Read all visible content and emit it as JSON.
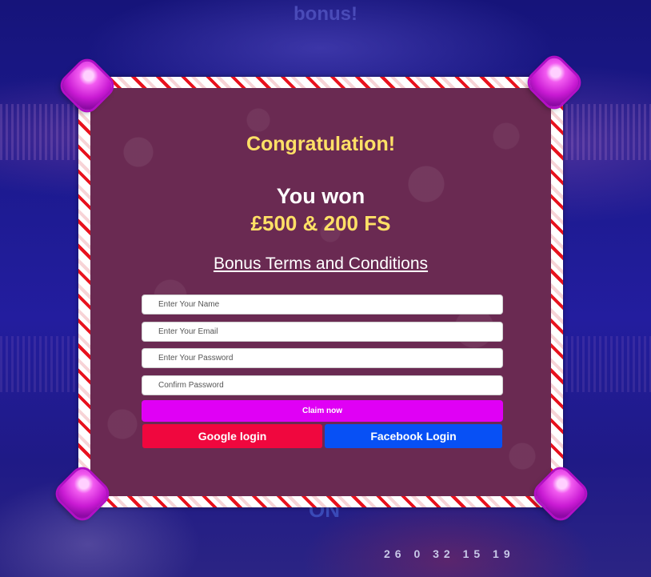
{
  "background": {
    "headline_fragment": "bonus!",
    "sign_text": "ON",
    "roulette_numbers": "26 0 32 15 19"
  },
  "modal": {
    "title": "Congratulation!",
    "won_label": "You won",
    "prize": "£500 & 200 FS",
    "terms_link": "Bonus Terms and Conditions"
  },
  "form": {
    "name_placeholder": "Enter Your Name",
    "email_placeholder": "Enter Your Email",
    "password_placeholder": "Enter Your Password",
    "confirm_placeholder": "Confirm Password",
    "claim_label": "Claim now",
    "google_label": "Google login",
    "facebook_label": "Facebook Login"
  },
  "colors": {
    "title_yellow": "#ffe066",
    "panel": "#6a2a52",
    "claim_button": "#e000f5",
    "google_button": "#f0073e",
    "facebook_button": "#0750f5",
    "frame_stripe": "#e8121e"
  }
}
